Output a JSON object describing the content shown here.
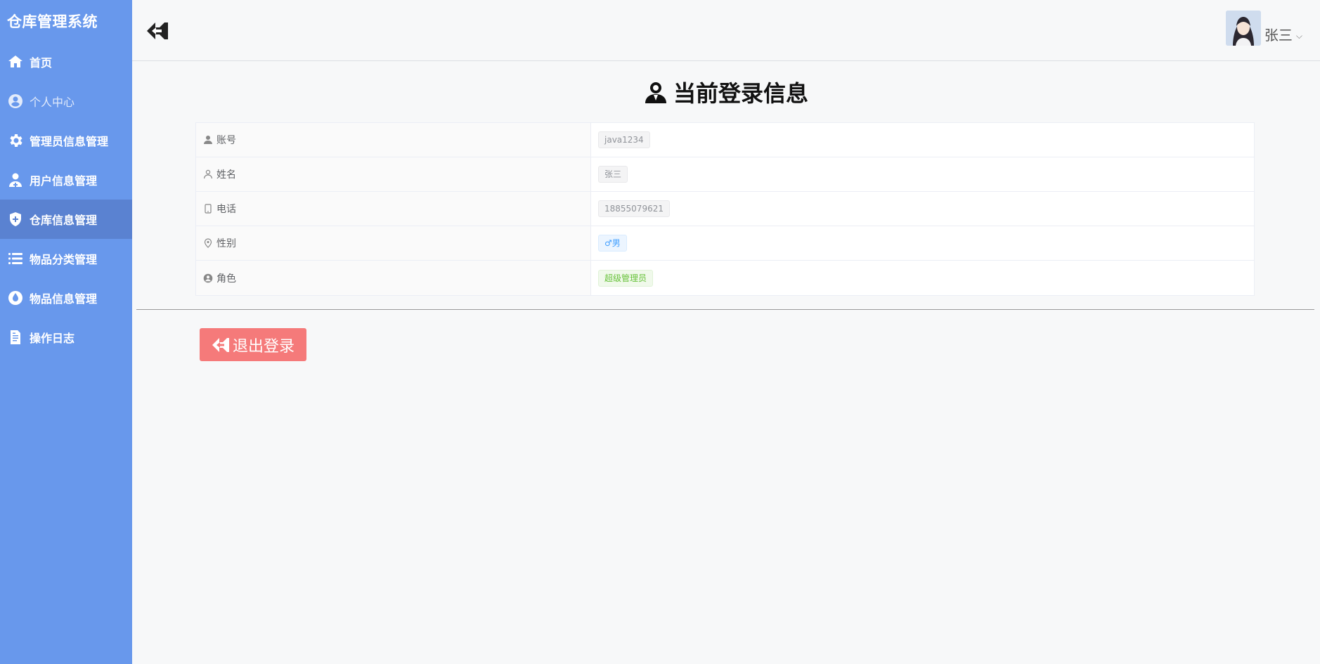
{
  "sidebar": {
    "brand": "仓库管理系统",
    "items": [
      {
        "label": "首页",
        "icon": "home-icon"
      },
      {
        "label": "个人中心",
        "icon": "user-circle-icon"
      },
      {
        "label": "管理员信息管理",
        "icon": "gear-icon"
      },
      {
        "label": "用户信息管理",
        "icon": "user-add-icon"
      },
      {
        "label": "仓库信息管理",
        "icon": "shield-icon"
      },
      {
        "label": "物品分类管理",
        "icon": "list-icon"
      },
      {
        "label": "物品信息管理",
        "icon": "drop-icon"
      },
      {
        "label": "操作日志",
        "icon": "document-icon"
      }
    ]
  },
  "header": {
    "user_name": "张三",
    "caret": "⌵"
  },
  "page": {
    "title": "当前登录信息"
  },
  "info": {
    "rows": [
      {
        "label": "账号",
        "value": "java1234"
      },
      {
        "label": "姓名",
        "value": "张三"
      },
      {
        "label": "电话",
        "value": "18855079621"
      },
      {
        "label": "性别",
        "value": "♂男"
      },
      {
        "label": "角色",
        "value": "超级管理员"
      }
    ]
  },
  "actions": {
    "logout_label": "退出登录"
  },
  "colors": {
    "sidebar_bg": "#6898ec",
    "sidebar_active": "#5a82d1",
    "logout_bg": "#f57a7a"
  }
}
